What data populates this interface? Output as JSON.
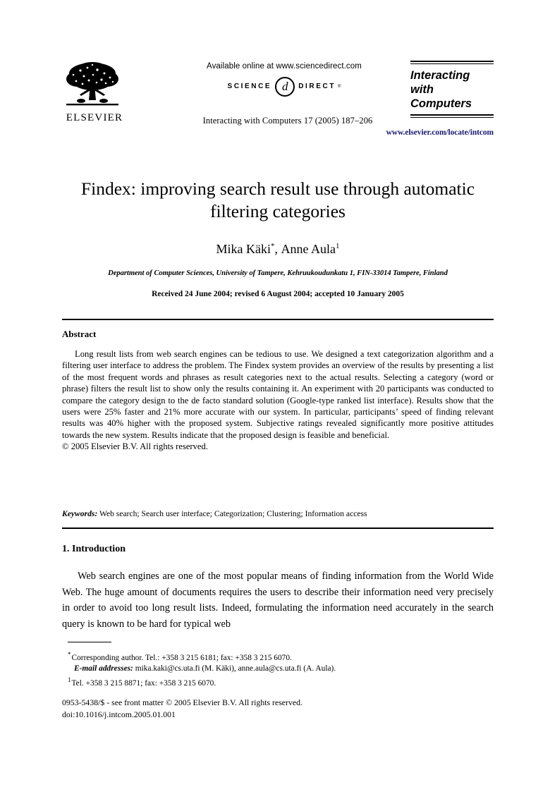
{
  "masthead": {
    "available_online": "Available online at www.sciencedirect.com",
    "sd_science": "SCIENCE",
    "sd_mark": "d",
    "sd_direct": "DIRECT",
    "sd_registered": "®",
    "publisher_name": "ELSEVIER",
    "journal_citation": "Interacting with Computers 17 (2005) 187–206",
    "nameplate_line1": "Interacting",
    "nameplate_line2": "with",
    "nameplate_line3": "Computers",
    "elsevier_url": "www.elsevier.com/locate/intcom",
    "url_color": "#191970"
  },
  "title_block": {
    "title": "Findex: improving search result use through automatic filtering categories",
    "authors_text": "Mika Käki*, Anne Aula",
    "author1": "Mika Käki",
    "author1_marker": "*",
    "author2": "Anne Aula",
    "author2_marker": "1",
    "affiliation": "Department of Computer Sciences, University of Tampere, Kehruukoudunkatu 1, FIN-33014 Tampere, Finland",
    "received": "Received 24 June 2004; revised 6 August 2004; accepted 10 January 2005"
  },
  "abstract": {
    "heading": "Abstract",
    "body": "Long result lists from web search engines can be tedious to use. We designed a text categorization algorithm and a filtering user interface to address the problem. The Findex system provides an overview of the results by presenting a list of the most frequent words and phrases as result categories next to the actual results. Selecting a category (word or phrase) filters the result list to show only the results containing it. An experiment with 20 participants was conducted to compare the category design to the de facto standard solution (Google-type ranked list interface). Results show that the users were 25% faster and 21% more accurate with our system. In particular, participants’ speed of finding relevant results was 40% higher with the proposed system. Subjective ratings revealed significantly more positive attitudes towards the new system. Results indicate that the proposed design is feasible and beneficial.",
    "copyright": "© 2005 Elsevier B.V. All rights reserved."
  },
  "keywords": {
    "label": "Keywords:",
    "values": "Web search; Search user interface; Categorization; Clustering; Information access"
  },
  "introduction": {
    "heading": "1. Introduction",
    "body": "Web search engines are one of the most popular means of finding information from the World Wide Web. The huge amount of documents requires the users to describe their information need very precisely in order to avoid too long result lists. Indeed, formulating the information need accurately in the search query is known to be hard for typical web"
  },
  "footnotes": {
    "corresponding_marker": "*",
    "corresponding": "Corresponding author. Tel.: +358 3 215 6181; fax: +358 3 215 6070.",
    "email_label": "E-mail addresses:",
    "email_values": "mika.kaki@cs.uta.fi (M. Käki), anne.aula@cs.uta.fi (A. Aula).",
    "second_marker": "1",
    "second": "Tel. +358 3 215 8871; fax: +358 3 215 6070."
  },
  "imprint": {
    "issn_line": "0953-5438/$ - see front matter © 2005 Elsevier B.V. All rights reserved.",
    "doi_line": "doi:10.1016/j.intcom.2005.01.001"
  }
}
